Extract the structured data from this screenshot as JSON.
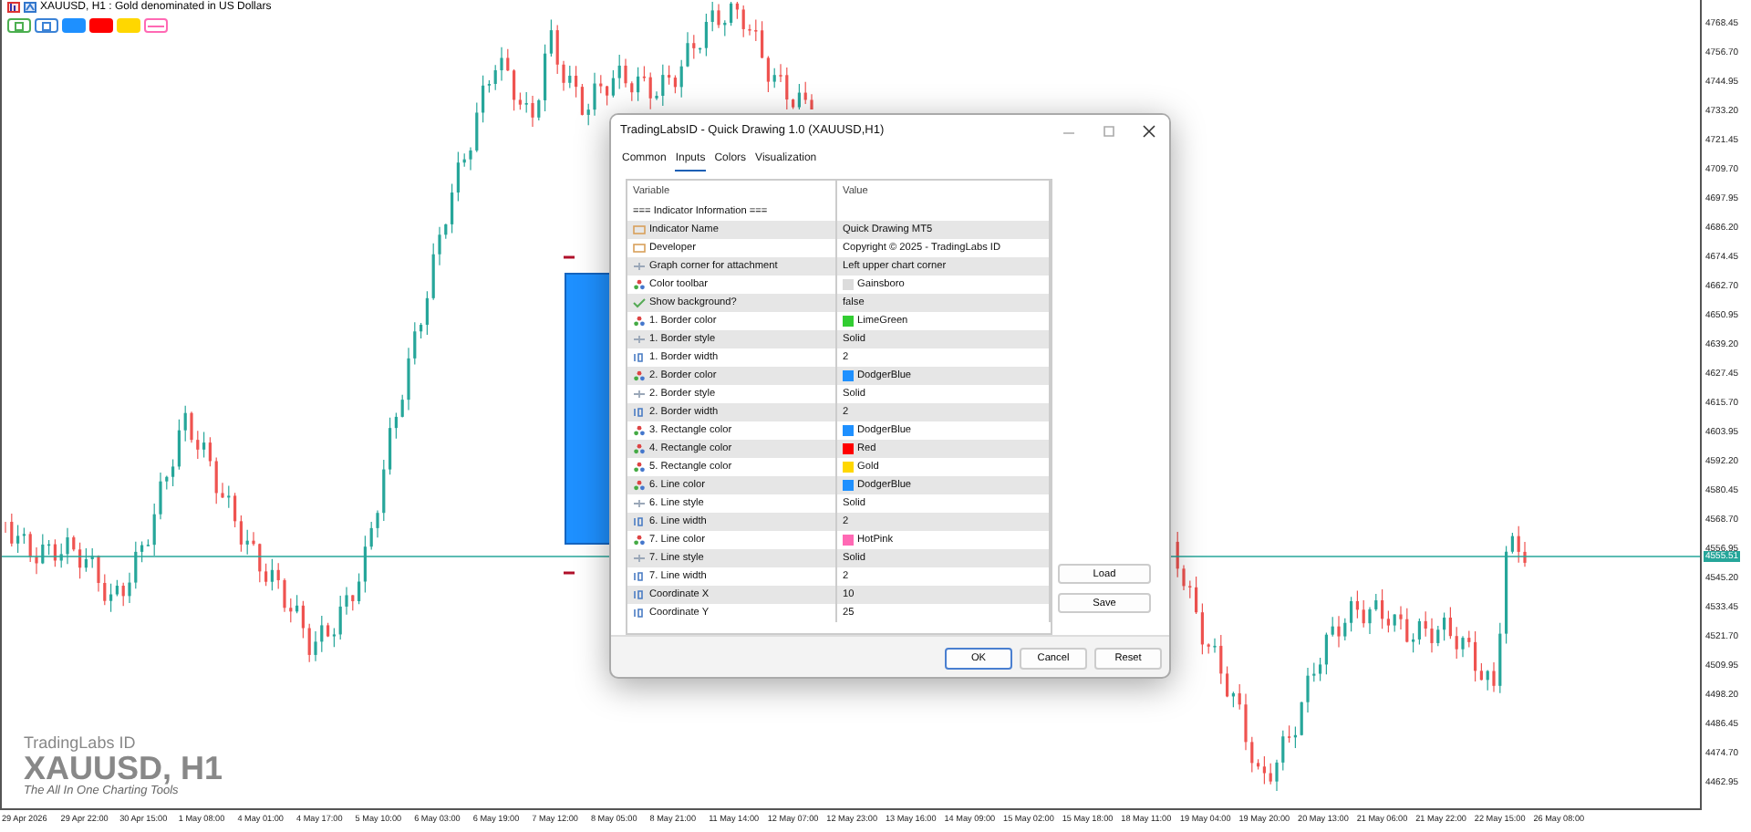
{
  "chart": {
    "title": "XAUUSD, H1 : Gold denominated in US Dollars",
    "toolbar": [
      {
        "kind": "outline",
        "color": "#4caf50"
      },
      {
        "kind": "outline",
        "color": "#3b82d6"
      },
      {
        "kind": "fill",
        "color": "#1e90ff"
      },
      {
        "kind": "fill",
        "color": "#ff0000"
      },
      {
        "kind": "fill",
        "color": "#ffd700"
      },
      {
        "kind": "line",
        "color": "#ff69b4"
      }
    ],
    "branding": {
      "company": "TradingLabs ID",
      "symbol": "XAUUSD, H1",
      "tagline": "The All In One Charting Tools"
    },
    "price_labels": [
      "4768.45",
      "4756.70",
      "4744.95",
      "4733.20",
      "4721.45",
      "4709.70",
      "4697.95",
      "4686.20",
      "4674.45",
      "4662.70",
      "4650.95",
      "4639.20",
      "4627.45",
      "4615.70",
      "4603.95",
      "4592.20",
      "4580.45",
      "4568.70",
      "4556.95",
      "4545.20",
      "4533.45",
      "4521.70",
      "4509.95",
      "4498.20",
      "4486.45",
      "4474.70",
      "4462.95"
    ],
    "current_price": "4555.51",
    "time_labels": [
      "29 Apr 2026",
      "29 Apr 22:00",
      "30 Apr 15:00",
      "1 May 08:00",
      "4 May 01:00",
      "4 May 17:00",
      "5 May 10:00",
      "6 May 03:00",
      "6 May 19:00",
      "7 May 12:00",
      "8 May 05:00",
      "8 May 21:00",
      "11 May 14:00",
      "12 May 07:00",
      "12 May 23:00",
      "13 May 16:00",
      "14 May 09:00",
      "15 May 02:00",
      "15 May 18:00",
      "18 May 11:00",
      "19 May 04:00",
      "19 May 20:00",
      "20 May 13:00",
      "21 May 06:00",
      "21 May 22:00",
      "22 May 15:00",
      "26 May 08:00"
    ]
  },
  "dialog": {
    "title": "TradingLabsID - Quick Drawing 1.0 (XAUUSD,H1)",
    "tabs": [
      {
        "label": "Common",
        "selected": false
      },
      {
        "label": "Inputs",
        "selected": true
      },
      {
        "label": "Colors",
        "selected": false
      },
      {
        "label": "Visualization",
        "selected": false
      }
    ],
    "columns": [
      "Variable",
      "Value"
    ],
    "rows": [
      {
        "kind": "header",
        "variable": "=== Indicator Information ==="
      },
      {
        "kind": "string",
        "variable": "Indicator Name",
        "value": "Quick Drawing MT5"
      },
      {
        "kind": "string",
        "variable": "Developer",
        "value": "Copyright © 2025 - TradingLabs ID"
      },
      {
        "kind": "enum",
        "variable": "Graph corner for attachment",
        "value": "Left upper chart corner"
      },
      {
        "kind": "color",
        "variable": "Color toolbar",
        "value": "Gainsboro",
        "color": "#dcdcdc"
      },
      {
        "kind": "bool",
        "variable": "Show background?",
        "value": "false"
      },
      {
        "kind": "color",
        "variable": "1. Border color",
        "value": "LimeGreen",
        "color": "#32cd32"
      },
      {
        "kind": "enum",
        "variable": "1. Border style",
        "value": "Solid"
      },
      {
        "kind": "int",
        "variable": "1. Border width",
        "value": "2"
      },
      {
        "kind": "color",
        "variable": "2. Border color",
        "value": "DodgerBlue",
        "color": "#1e90ff"
      },
      {
        "kind": "enum",
        "variable": "2. Border style",
        "value": "Solid"
      },
      {
        "kind": "int",
        "variable": "2. Border width",
        "value": "2"
      },
      {
        "kind": "color",
        "variable": "3. Rectangle color",
        "value": "DodgerBlue",
        "color": "#1e90ff"
      },
      {
        "kind": "color",
        "variable": "4. Rectangle color",
        "value": "Red",
        "color": "#ff0000"
      },
      {
        "kind": "color",
        "variable": "5. Rectangle color",
        "value": "Gold",
        "color": "#ffd700"
      },
      {
        "kind": "color",
        "variable": "6. Line color",
        "value": "DodgerBlue",
        "color": "#1e90ff"
      },
      {
        "kind": "enum",
        "variable": "6. Line style",
        "value": "Solid"
      },
      {
        "kind": "int",
        "variable": "6. Line width",
        "value": "2"
      },
      {
        "kind": "color",
        "variable": "7. Line color",
        "value": "HotPink",
        "color": "#ff69b4"
      },
      {
        "kind": "enum",
        "variable": "7. Line style",
        "value": "Solid"
      },
      {
        "kind": "int",
        "variable": "7. Line width",
        "value": "2"
      },
      {
        "kind": "int",
        "variable": "Coordinate X",
        "value": "10"
      },
      {
        "kind": "int",
        "variable": "Coordinate Y",
        "value": "25"
      }
    ],
    "side_buttons": [
      "Load",
      "Save"
    ],
    "buttons": [
      "OK",
      "Cancel",
      "Reset"
    ]
  }
}
